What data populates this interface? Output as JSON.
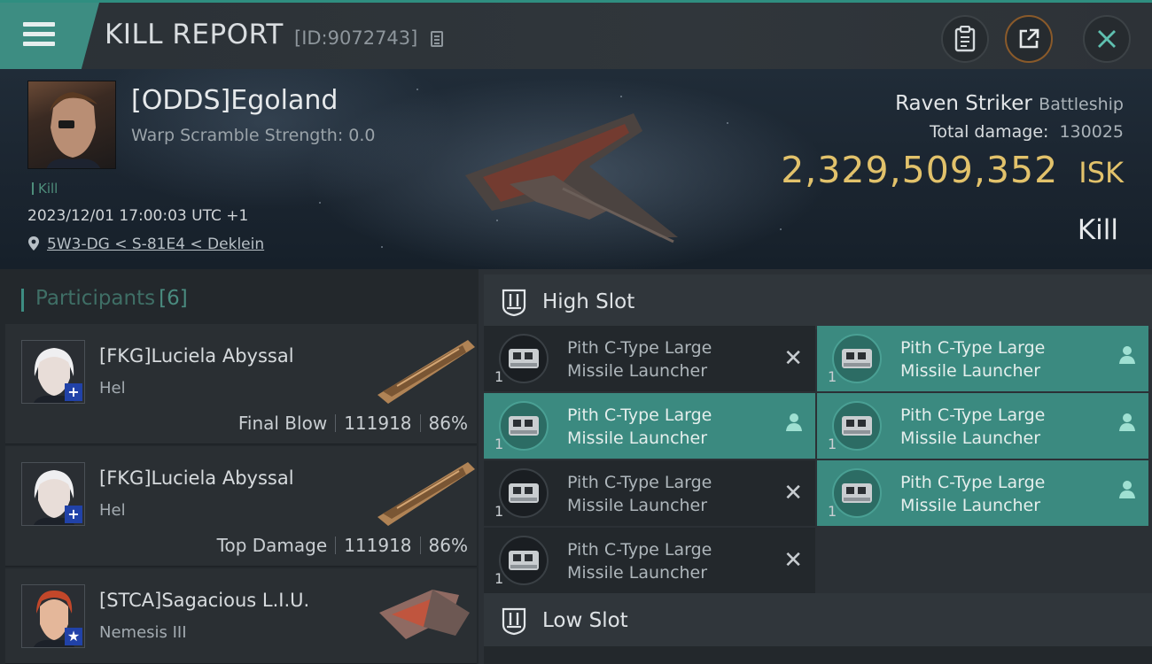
{
  "header": {
    "title": "KILL REPORT",
    "id_text": "[ID:9072743]",
    "buttons": [
      "copy-report",
      "share",
      "close"
    ]
  },
  "victim": {
    "name": "[ODDS]Egoland",
    "warp": "Warp Scramble Strength: 0.0",
    "tag": "Kill",
    "date": "2023/12/01 17:00:03 UTC +1",
    "location": "5W3-DG < S-81E4 < Deklein",
    "ship": "Raven Striker",
    "ship_class": "Battleship",
    "total_damage_label": "Total damage:",
    "total_damage": "130025",
    "isk_value": "2,329,509,352",
    "isk_unit": "ISK",
    "result": "Kill"
  },
  "participants": {
    "label": "Participants",
    "count": "[6]",
    "rows": [
      {
        "name": "[FKG]Luciela Abyssal",
        "ship": "Hel",
        "role": "Final Blow",
        "damage": "111918",
        "percent": "86%",
        "badge": "+"
      },
      {
        "name": "[FKG]Luciela Abyssal",
        "ship": "Hel",
        "role": "Top Damage",
        "damage": "111918",
        "percent": "86%",
        "badge": "+"
      },
      {
        "name": "[STCA]Sagacious L.I.U.",
        "ship": "Nemesis III",
        "badge": "★"
      }
    ]
  },
  "slots": {
    "high_label": "High Slot",
    "low_label": "Low Slot",
    "modules": [
      {
        "line1": "Pith C-Type Large",
        "line2": "Missile Launcher",
        "qty": "1",
        "state": "destroyed"
      },
      {
        "line1": "Pith C-Type Large",
        "line2": "Missile Launcher",
        "qty": "1",
        "state": "dropped"
      },
      {
        "line1": "Pith C-Type Large",
        "line2": "Missile Launcher",
        "qty": "1",
        "state": "dropped"
      },
      {
        "line1": "Pith C-Type Large",
        "line2": "Missile Launcher",
        "qty": "1",
        "state": "dropped"
      },
      {
        "line1": "Pith C-Type Large",
        "line2": "Missile Launcher",
        "qty": "1",
        "state": "destroyed"
      },
      {
        "line1": "Pith C-Type Large",
        "line2": "Missile Launcher",
        "qty": "1",
        "state": "dropped"
      },
      {
        "line1": "Pith C-Type Large",
        "line2": "Missile Launcher",
        "qty": "1",
        "state": "destroyed"
      }
    ]
  },
  "colors": {
    "accent": "#3d8d82",
    "isk": "#e2c26b",
    "dropped_bg": "#3b8a80",
    "destroyed_bg": "#23282c"
  }
}
